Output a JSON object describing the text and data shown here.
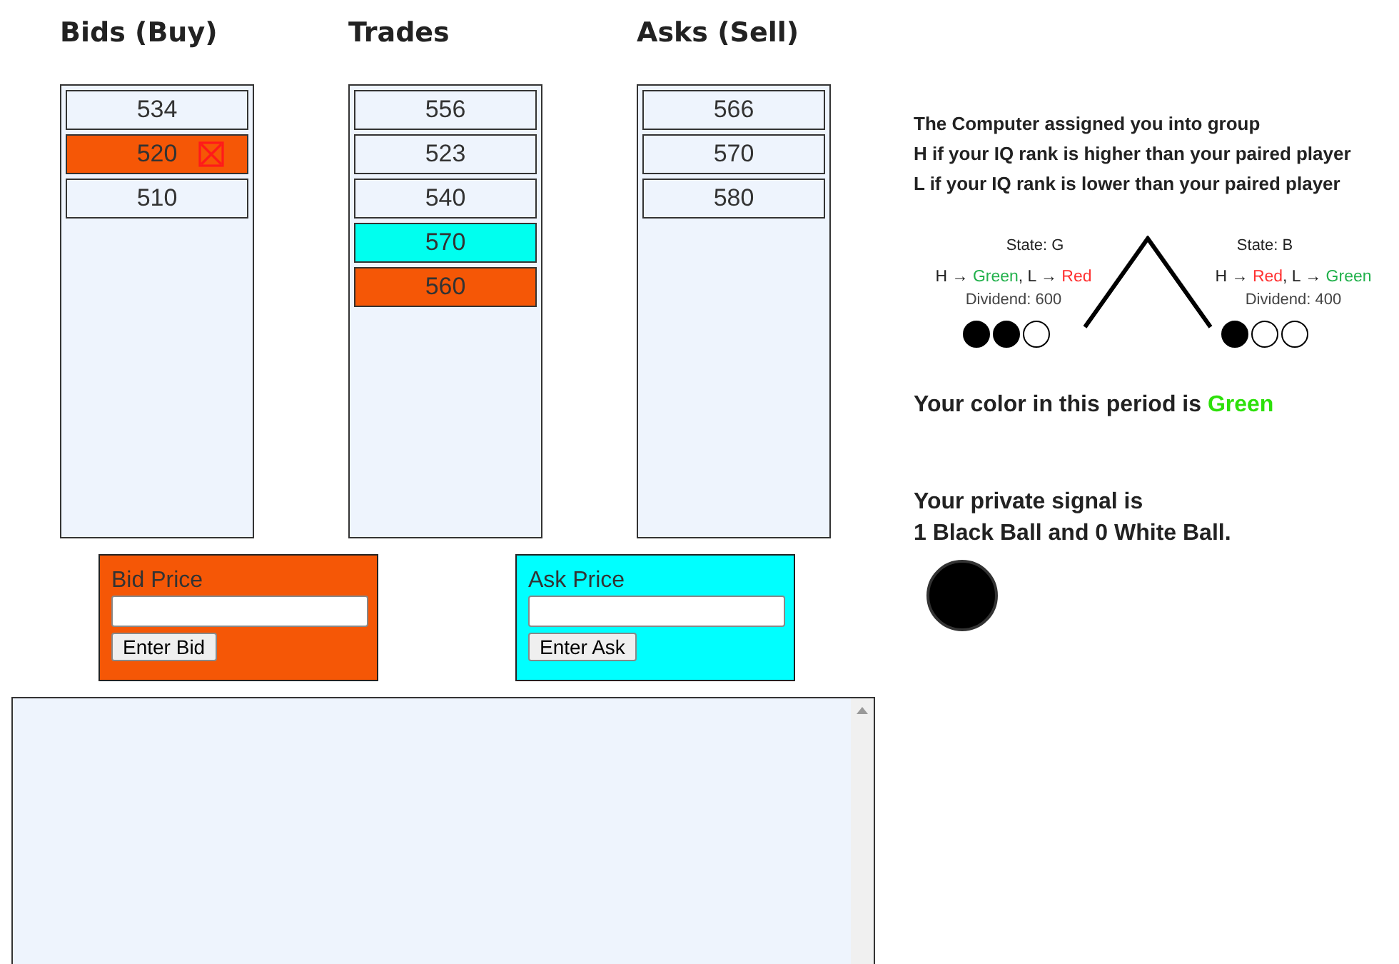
{
  "book": [
    {
      "heading": "Bids (Buy)",
      "items": [
        {
          "price": "534",
          "color": "#eef4fd",
          "cancelable": false
        },
        {
          "price": "520",
          "color": "#f55706",
          "cancelable": true
        },
        {
          "price": "510",
          "color": "#eef4fd",
          "cancelable": false
        }
      ]
    },
    {
      "heading": "Trades",
      "items": [
        {
          "price": "556",
          "color": "#eef4fd",
          "cancelable": false
        },
        {
          "price": "523",
          "color": "#eef4fd",
          "cancelable": false
        },
        {
          "price": "540",
          "color": "#eef4fd",
          "cancelable": false
        },
        {
          "price": "570",
          "color": "#00ffef",
          "cancelable": false
        },
        {
          "price": "560",
          "color": "#f55706",
          "cancelable": false
        }
      ]
    },
    {
      "heading": "Asks (Sell)",
      "items": [
        {
          "price": "566",
          "color": "#eef4fd",
          "cancelable": false
        },
        {
          "price": "570",
          "color": "#eef4fd",
          "cancelable": false
        },
        {
          "price": "580",
          "color": "#eef4fd",
          "cancelable": false
        }
      ]
    }
  ],
  "forms": [
    {
      "label": "Bid Price",
      "button": "Enter Bid",
      "color": "#f55706"
    },
    {
      "label": "Ask Price",
      "button": "Enter Ask",
      "color": "#00ffff"
    }
  ],
  "info": {
    "lines": [
      "The Computer assigned you into group",
      "H if your IQ rank is higher than your paired player",
      "L if your IQ rank is lower than your paired player"
    ]
  },
  "states": [
    {
      "state": "State: G",
      "rule": [
        {
          "text": "H → "
        },
        {
          "text": "Green",
          "color": "#22b14c"
        },
        {
          "text": ", L → "
        },
        {
          "text": "Red",
          "color": "#ff3030"
        }
      ],
      "dividend": "Dividend: 600",
      "balls": [
        {
          "kind": "black"
        },
        {
          "kind": "black"
        },
        {
          "kind": "white"
        }
      ]
    },
    {
      "state": "State: B",
      "rule": [
        {
          "text": "H → "
        },
        {
          "text": "Red",
          "color": "#ff3030"
        },
        {
          "text": ", L → "
        },
        {
          "text": "Green",
          "color": "#22b14c"
        }
      ],
      "dividend": "Dividend: 400",
      "balls": [
        {
          "kind": "black"
        },
        {
          "kind": "white"
        },
        {
          "kind": "white"
        }
      ]
    }
  ],
  "color_line": [
    {
      "text": "Your color in this period is "
    },
    {
      "text": "Green",
      "color": "#2de00a"
    }
  ],
  "signal": {
    "lines": [
      "Your private signal is",
      "1 Black Ball and 0 White Ball."
    ],
    "ball": {
      "kind": "black"
    }
  }
}
